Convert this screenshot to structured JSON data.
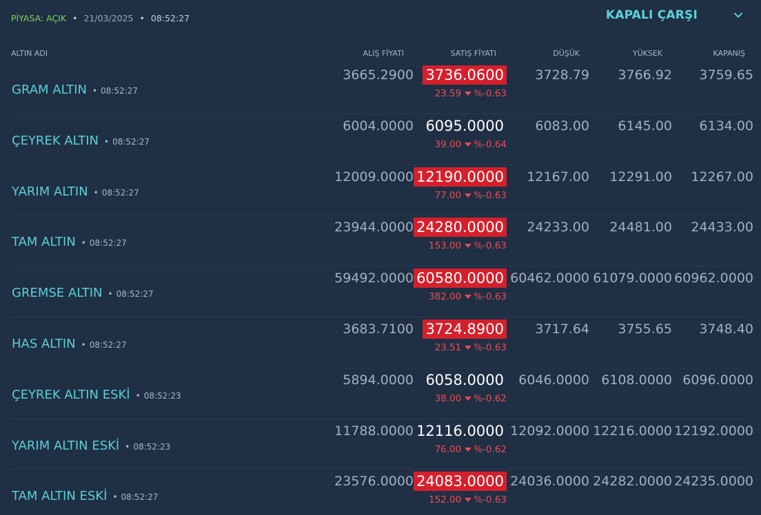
{
  "status": {
    "market_label": "PİYASA: AÇIK",
    "separator": "•",
    "date": "21/03/2025",
    "time": "08:52:27"
  },
  "market_select": {
    "label": "KAPALI ÇARŞI",
    "icon": "chevron-down-icon"
  },
  "columns": {
    "name": "ALTIN ADI",
    "buy": "ALIŞ FİYATI",
    "sell": "SATIŞ FİYATI",
    "low": "DÜŞÜK",
    "high": "YÜKSEK",
    "close": "KAPANIŞ"
  },
  "rows": [
    {
      "name": "GRAM ALTIN",
      "time": "08:52:27",
      "buy": "3665.2900",
      "sell": "3736.0600",
      "sell_highlight": true,
      "change": "23.59",
      "change_pct": "%-0.63",
      "low": "3728.79",
      "high": "3766.92",
      "close": "3759.65"
    },
    {
      "name": "ÇEYREK ALTIN",
      "time": "08:52:27",
      "buy": "6004.0000",
      "sell": "6095.0000",
      "sell_highlight": false,
      "change": "39.00",
      "change_pct": "%-0.64",
      "low": "6083.00",
      "high": "6145.00",
      "close": "6134.00"
    },
    {
      "name": "YARIM ALTIN",
      "time": "08:52:27",
      "buy": "12009.0000",
      "sell": "12190.0000",
      "sell_highlight": true,
      "change": "77.00",
      "change_pct": "%-0.63",
      "low": "12167.00",
      "high": "12291.00",
      "close": "12267.00"
    },
    {
      "name": "TAM ALTIN",
      "time": "08:52:27",
      "buy": "23944.0000",
      "sell": "24280.0000",
      "sell_highlight": true,
      "change": "153.00",
      "change_pct": "%-0.63",
      "low": "24233.00",
      "high": "24481.00",
      "close": "24433.00"
    },
    {
      "name": "GREMSE ALTIN",
      "time": "08:52:27",
      "buy": "59492.0000",
      "sell": "60580.0000",
      "sell_highlight": true,
      "change": "382.00",
      "change_pct": "%-0.63",
      "low": "60462.0000",
      "high": "61079.0000",
      "close": "60962.0000"
    },
    {
      "name": "HAS ALTIN",
      "time": "08:52:27",
      "buy": "3683.7100",
      "sell": "3724.8900",
      "sell_highlight": true,
      "change": "23.51",
      "change_pct": "%-0.63",
      "low": "3717.64",
      "high": "3755.65",
      "close": "3748.40"
    },
    {
      "name": "ÇEYREK ALTIN ESKİ",
      "time": "08:52:23",
      "buy": "5894.0000",
      "sell": "6058.0000",
      "sell_highlight": false,
      "change": "38.00",
      "change_pct": "%-0.62",
      "low": "6046.0000",
      "high": "6108.0000",
      "close": "6096.0000"
    },
    {
      "name": "YARIM ALTIN ESKİ",
      "time": "08:52:23",
      "buy": "11788.0000",
      "sell": "12116.0000",
      "sell_highlight": false,
      "change": "76.00",
      "change_pct": "%-0.62",
      "low": "12092.0000",
      "high": "12216.0000",
      "close": "12192.0000"
    },
    {
      "name": "TAM ALTIN ESKİ",
      "time": "08:52:27",
      "buy": "23576.0000",
      "sell": "24083.0000",
      "sell_highlight": true,
      "change": "152.00",
      "change_pct": "%-0.63",
      "low": "24036.0000",
      "high": "24282.0000",
      "close": "24235.0000"
    }
  ],
  "colors": {
    "background": "#1f2f44",
    "accent": "#5ccfd6",
    "market_open": "#7fd653",
    "highlight": "#d5202c",
    "negative": "#f04b52"
  }
}
